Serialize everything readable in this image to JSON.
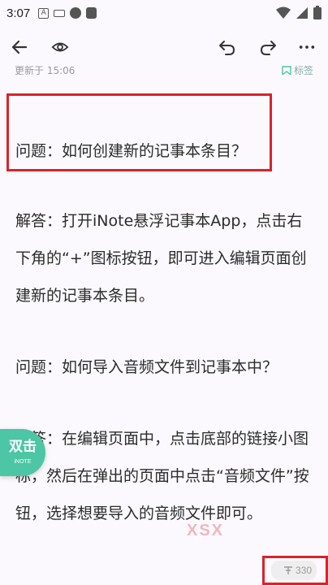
{
  "status_bar": {
    "time": "3:07",
    "notification_icons": [
      "a-icon",
      "keyboard-icon",
      "circle-icon",
      "square-icon"
    ],
    "system_icons": [
      "wifi-icon",
      "signal-icon",
      "battery-icon"
    ]
  },
  "toolbar": {
    "back_icon": "arrow-left-icon",
    "preview_icon": "eye-icon",
    "undo_icon": "undo-icon",
    "redo_icon": "redo-icon",
    "more_icon": "more-horizontal-icon"
  },
  "meta": {
    "updated": "更新于 15:06",
    "tag_label": "标签"
  },
  "paragraphs": [
    "问题：如何创建新的记事本条目？",
    "解答：打开iNote悬浮记事本App，点击右下角的“+”图标按钮，即可进入编辑页面创建新的记事本条目。",
    "问题：如何导入音频文件到记事本中？",
    "解答：在编辑页面中，点击底部的链接小图标，然后在弹出的页面中点击“音频文件”按钮，选择想要导入的音频文件即可。"
  ],
  "fab": {
    "label": "双击",
    "sub": "iNOTE"
  },
  "watermark": "XSX",
  "word_count": "330",
  "colors": {
    "highlight": "#d8232a",
    "fab": "#4cc6a4",
    "background": "#fbf9fd"
  }
}
